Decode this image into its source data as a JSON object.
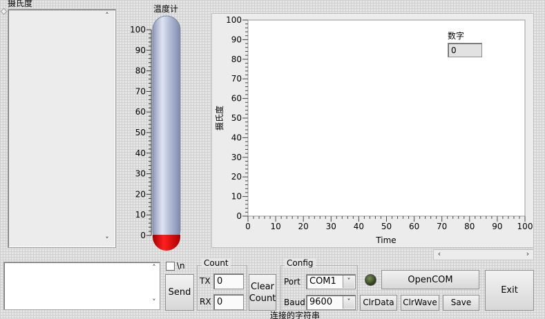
{
  "left_list": {
    "title": "摄氏度"
  },
  "thermometer": {
    "title": "温度计",
    "value": 0,
    "scale_min": 0,
    "scale_max": 100,
    "ticks": [
      "0",
      "10",
      "20",
      "30",
      "40",
      "50",
      "60",
      "70",
      "80",
      "90",
      "100"
    ],
    "colors": {
      "tube": "#aab5d0",
      "bulb": "#e00000"
    }
  },
  "chart": {
    "ylabel": "摄氏度",
    "xlabel": "Time",
    "digital_label": "数字",
    "digital_value": "0"
  },
  "chart_data": {
    "type": "line",
    "title": "",
    "xlabel": "Time",
    "ylabel": "摄氏度",
    "xlim": [
      0,
      100
    ],
    "ylim": [
      0,
      100
    ],
    "x_ticks": [
      "0",
      "10",
      "20",
      "30",
      "40",
      "50",
      "60",
      "70",
      "80",
      "90",
      "100"
    ],
    "y_ticks": [
      "0",
      "10",
      "20",
      "30",
      "40",
      "50",
      "60",
      "70",
      "80",
      "90",
      "100"
    ],
    "series": []
  },
  "newline": {
    "label": "\\n",
    "checked": false
  },
  "send_button": "Send",
  "count": {
    "title": "Count",
    "tx_label": "TX",
    "tx_value": "0",
    "rx_label": "RX",
    "rx_value": "0"
  },
  "clear_count_button": "Clear Count",
  "config": {
    "title": "Config",
    "port_label": "Port",
    "port_value": "COM1",
    "baud_label": "Baud",
    "baud_value": "9600"
  },
  "open_com_button": "OpenCOM",
  "clr_data_button": "ClrData",
  "clr_wave_button": "ClrWave",
  "save_button": "Save",
  "exit_button": "Exit",
  "bottom_caption": "连接的字符串"
}
